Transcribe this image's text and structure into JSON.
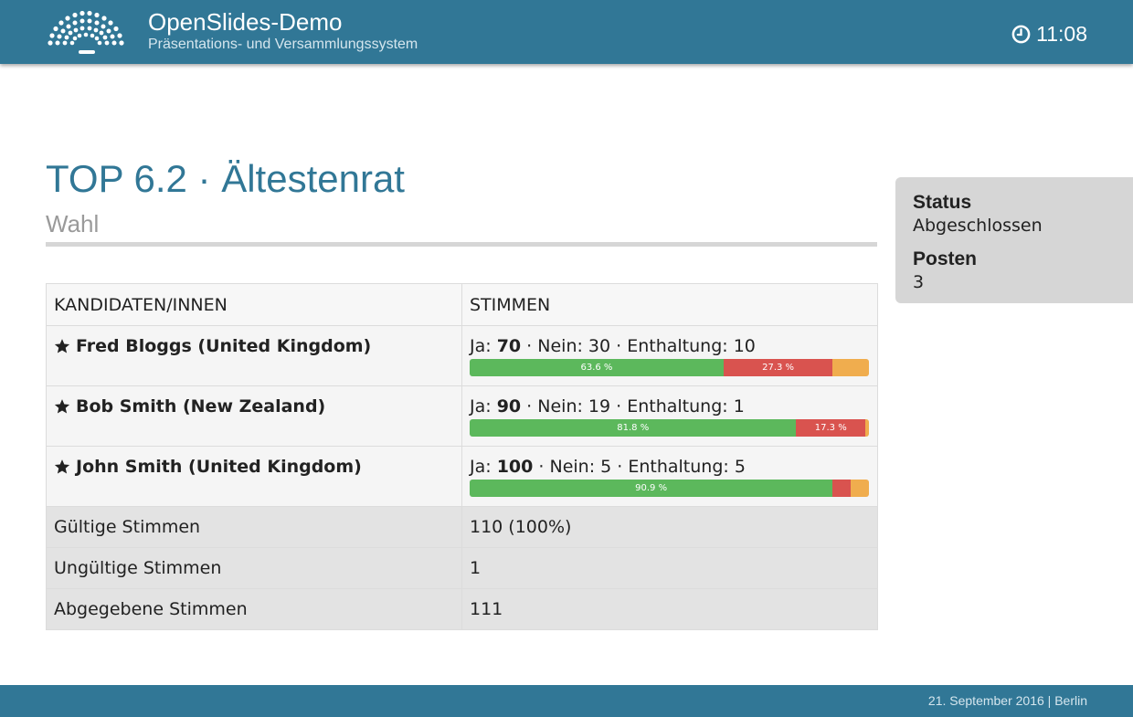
{
  "header": {
    "app_title": "OpenSlides-Demo",
    "app_subtitle": "Präsentations- und Versammlungssystem",
    "clock_time": "11:08",
    "brand_color": "#317796"
  },
  "slide": {
    "title": "TOP 6.2 · Ältestenrat",
    "subtitle": "Wahl"
  },
  "table": {
    "col_candidates": "KANDIDATEN/INNEN",
    "col_votes": "STIMMEN",
    "candidates": [
      {
        "name": "Fred Bloggs (United Kingdom)",
        "yes_label": "Ja: ",
        "yes": "70",
        "no_text": " · Nein: 30 · Enthaltung: 10",
        "yes_pct": 63.6,
        "no_pct": 27.3,
        "abs_pct": 9.1,
        "yes_pct_label": "63.6 %",
        "no_pct_label": "27.3 %",
        "abs_pct_label": ""
      },
      {
        "name": "Bob Smith (New Zealand)",
        "yes_label": "Ja: ",
        "yes": "90",
        "no_text": " · Nein: 19 · Enthaltung: 1",
        "yes_pct": 81.8,
        "no_pct": 17.3,
        "abs_pct": 0.9,
        "yes_pct_label": "81.8 %",
        "no_pct_label": "17.3 %",
        "abs_pct_label": ""
      },
      {
        "name": "John Smith (United Kingdom)",
        "yes_label": "Ja: ",
        "yes": "100",
        "no_text": " · Nein: 5 · Enthaltung: 5",
        "yes_pct": 90.9,
        "no_pct": 4.5,
        "abs_pct": 4.5,
        "yes_pct_label": "90.9 %",
        "no_pct_label": "",
        "abs_pct_label": ""
      }
    ],
    "summary": [
      {
        "label": "Gültige Stimmen",
        "value": "110 (100%)"
      },
      {
        "label": "Ungültige Stimmen",
        "value": "1"
      },
      {
        "label": "Abgegebene Stimmen",
        "value": "111"
      }
    ]
  },
  "status_box": {
    "status_label": "Status",
    "status_value": "Abgeschlossen",
    "posts_label": "Posten",
    "posts_value": "3"
  },
  "footer": {
    "text": "21. September 2016 | Berlin"
  },
  "colors": {
    "yes": "#5cb85c",
    "no": "#d9534f",
    "abstain": "#f0ad4e"
  },
  "icons": {
    "logo": "openslides-logo",
    "clock": "clock-icon",
    "elected": "star-icon"
  }
}
